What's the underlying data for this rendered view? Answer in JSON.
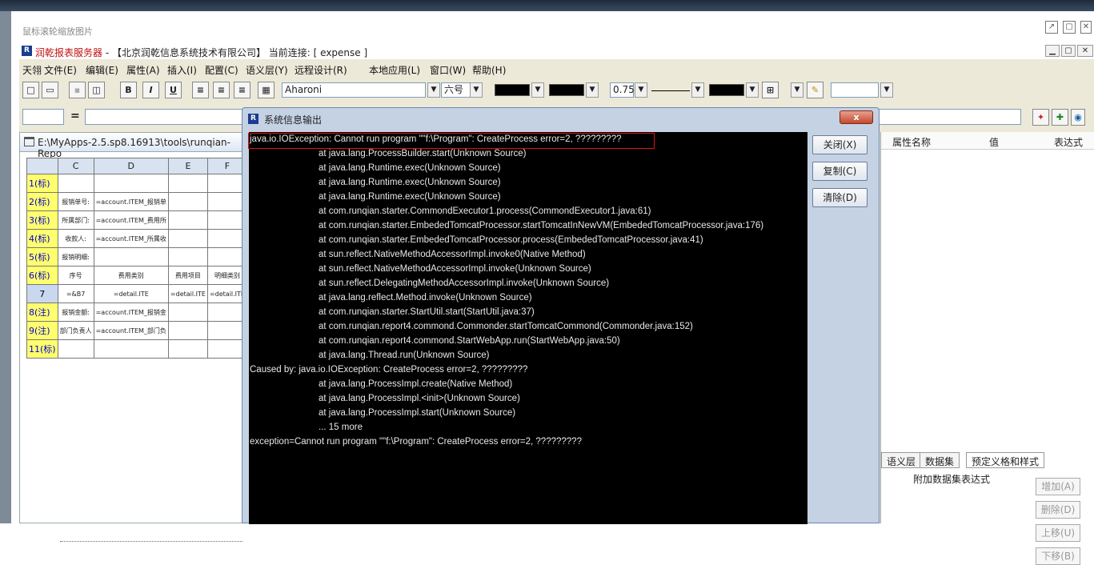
{
  "viewer": {
    "title": "鼠标滚轮缩放图片",
    "icons": [
      "↗",
      "▢",
      "✕"
    ]
  },
  "app": {
    "title_prefix": "润乾报表服务器",
    "title_rest": " - 【北京润乾信息系统技术有限公司】  当前连接: [ expense ]",
    "min": "▁",
    "max": "▢",
    "close": "✕"
  },
  "menu": [
    "天翎",
    "文件(E)",
    "编辑(E)",
    "属性(A)",
    "插入(I)",
    "配置(C)",
    "语义层(Y)",
    "远程设计(R)",
    "本地应用(L)",
    "窗口(W)",
    "帮助(H)"
  ],
  "toolbar": {
    "font": "Aharoni",
    "size": "六号",
    "line_width": "0.75"
  },
  "formula": {
    "eq": "="
  },
  "designer": {
    "path": "E:\\MyApps-2.5.sp8.16913\\tools\\runqian-Repo",
    "columns": [
      "C",
      "D",
      "E",
      "F"
    ],
    "rows": [
      {
        "h": "1(标)",
        "c": [
          "",
          "",
          "",
          ""
        ]
      },
      {
        "h": "2(标)",
        "c": [
          "报销单号:",
          "=account.ITEM_报销单",
          "",
          ""
        ]
      },
      {
        "h": "3(标)",
        "c": [
          "所属部门:",
          "=account.ITEM_费用所",
          "",
          ""
        ]
      },
      {
        "h": "4(标)",
        "c": [
          "收款人:",
          "=account.ITEM_所属收",
          "",
          ""
        ]
      },
      {
        "h": "5(标)",
        "c": [
          "报销明细:",
          "",
          "",
          ""
        ]
      },
      {
        "h": "6(标)",
        "c": [
          "序号",
          "费用类别",
          "费用项目",
          "明细类别"
        ]
      },
      {
        "h": "7",
        "c": [
          "=&B7",
          "=detail.ITE",
          "=detail.ITE",
          "=detail.ITE"
        ]
      },
      {
        "h": "8(注)",
        "c": [
          "报销金额:",
          "=account.ITEM_报销金",
          "",
          ""
        ]
      },
      {
        "h": "9(注)",
        "c": [
          "部门负责人",
          "=account.ITEM_部门负",
          "",
          ""
        ]
      },
      {
        "h": "11(标)",
        "c": [
          "",
          "",
          "",
          ""
        ]
      }
    ]
  },
  "right": {
    "headers": [
      "属性名称",
      "值",
      "表达式"
    ],
    "tabs": [
      "语义层",
      "数据集",
      "预定义格和样式"
    ],
    "expr_header": "附加数据集表达式",
    "buttons": [
      "增加(A)",
      "删除(D)",
      "上移(U)",
      "下移(B)"
    ]
  },
  "dialog": {
    "title": "系统信息输出",
    "close_glyph": "x",
    "buttons": [
      "关闭(X)",
      "复制(C)",
      "清除(D)"
    ],
    "lines": [
      {
        "t": "java.io.IOException: Cannot run program \"\"f:\\Program\": CreateProcess error=2, ?????????",
        "in": false
      },
      {
        "t": "at java.lang.ProcessBuilder.start(Unknown Source)",
        "in": true
      },
      {
        "t": "at java.lang.Runtime.exec(Unknown Source)",
        "in": true
      },
      {
        "t": "at java.lang.Runtime.exec(Unknown Source)",
        "in": true
      },
      {
        "t": "at java.lang.Runtime.exec(Unknown Source)",
        "in": true
      },
      {
        "t": "at com.runqian.starter.CommondExecutor1.process(CommondExecutor1.java:61)",
        "in": true
      },
      {
        "t": "at com.runqian.starter.EmbededTomcatProcessor.startTomcatInNewVM(EmbededTomcatProcessor.java:176)",
        "in": true
      },
      {
        "t": "at com.runqian.starter.EmbededTomcatProcessor.process(EmbededTomcatProcessor.java:41)",
        "in": true
      },
      {
        "t": "at sun.reflect.NativeMethodAccessorImpl.invoke0(Native Method)",
        "in": true
      },
      {
        "t": "at sun.reflect.NativeMethodAccessorImpl.invoke(Unknown Source)",
        "in": true
      },
      {
        "t": "at sun.reflect.DelegatingMethodAccessorImpl.invoke(Unknown Source)",
        "in": true
      },
      {
        "t": "at java.lang.reflect.Method.invoke(Unknown Source)",
        "in": true
      },
      {
        "t": "at com.runqian.starter.StartUtil.start(StartUtil.java:37)",
        "in": true
      },
      {
        "t": "at com.runqian.report4.commond.Commonder.startTomcatCommond(Commonder.java:152)",
        "in": true
      },
      {
        "t": "at com.runqian.report4.commond.StartWebApp.run(StartWebApp.java:50)",
        "in": true
      },
      {
        "t": "at java.lang.Thread.run(Unknown Source)",
        "in": true
      },
      {
        "t": "Caused by: java.io.IOException: CreateProcess error=2, ?????????",
        "in": false
      },
      {
        "t": "at java.lang.ProcessImpl.create(Native Method)",
        "in": true
      },
      {
        "t": "at java.lang.ProcessImpl.<init>(Unknown Source)",
        "in": true
      },
      {
        "t": "at java.lang.ProcessImpl.start(Unknown Source)",
        "in": true
      },
      {
        "t": "... 15 more",
        "in": true
      },
      {
        "t": "exception=Cannot run program \"\"f:\\Program\": CreateProcess error=2, ?????????",
        "in": false
      }
    ]
  }
}
